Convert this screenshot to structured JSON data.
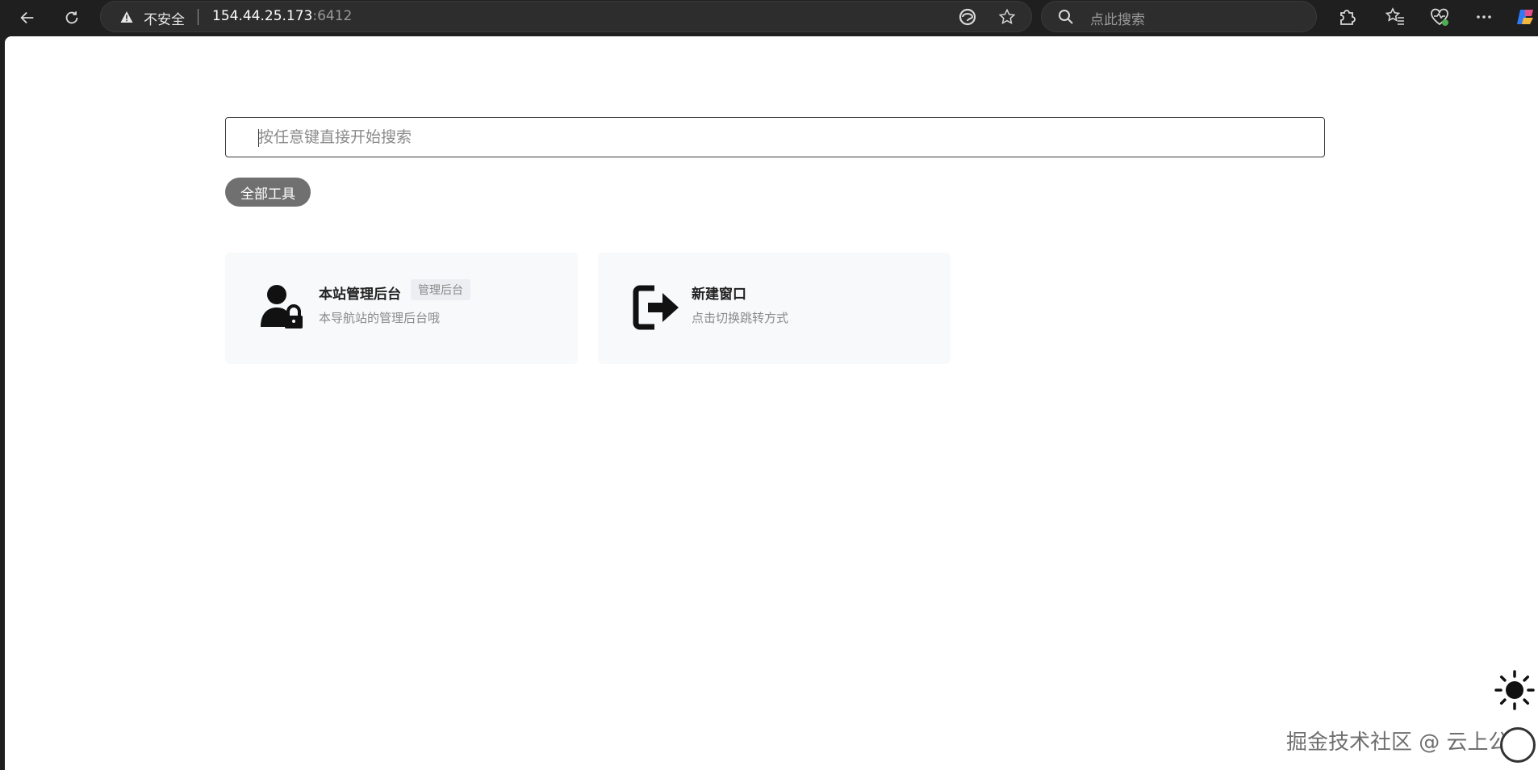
{
  "browser": {
    "insecure_label": "不安全",
    "url_host": "154.44.25.173",
    "url_port": ":6412",
    "search_placeholder": "点此搜索"
  },
  "page": {
    "search_placeholder": "按任意键直接开始搜索",
    "category_pill": "全部工具",
    "cards": [
      {
        "title": "本站管理后台",
        "tag": "管理后台",
        "desc": "本导航站的管理后台哦",
        "icon": "user-lock-icon"
      },
      {
        "title": "新建窗口",
        "tag": "",
        "desc": "点击切换跳转方式",
        "icon": "sign-out-icon"
      }
    ],
    "theme_toggle_icon": "sun-icon",
    "watermark": "掘金技术社区 @ 云上公园"
  }
}
